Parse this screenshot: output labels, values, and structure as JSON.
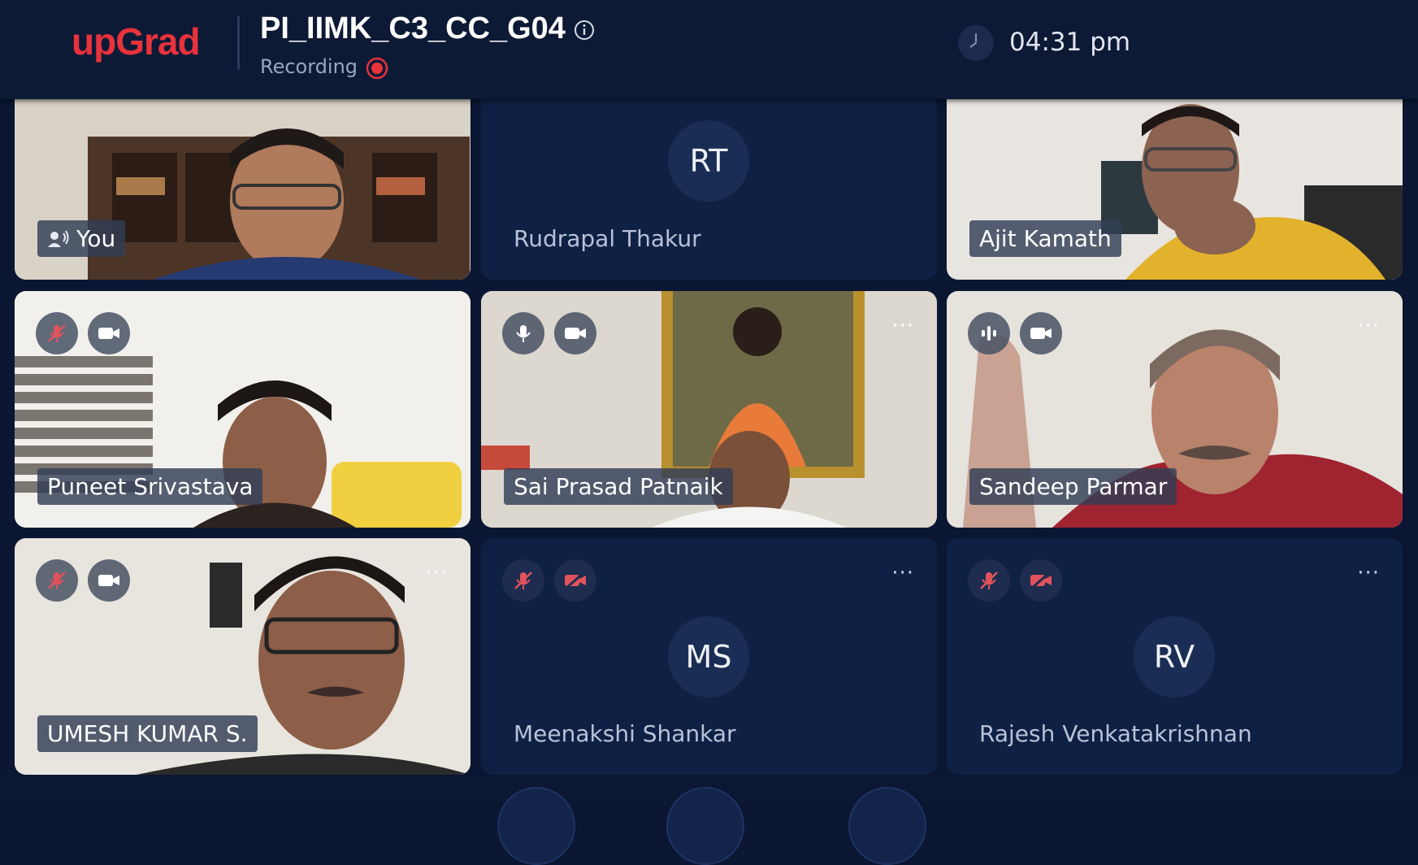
{
  "app": {
    "logo": "upGrad",
    "meeting_title": "PI_IIMK_C3_CC_G04",
    "recording_label": "Recording",
    "clock": "04:31 pm"
  },
  "participants": [
    {
      "name": "You",
      "video": true,
      "colors": [
        "#cfc6b8",
        "#5a3f2e",
        "#2a3a6a"
      ]
    },
    {
      "name": "Rudrapal Thakur",
      "initials": "RT",
      "video": false
    },
    {
      "name": "Ajit Kamath",
      "video": true,
      "colors": [
        "#e9e6e2",
        "#e2b22c",
        "#3b2b26"
      ]
    },
    {
      "name": "Puneet Srivastava",
      "video": true,
      "mic": "muted",
      "colors": [
        "#f1efeb",
        "#f0d040",
        "#2b2320"
      ]
    },
    {
      "name": "Sai Prasad Patnaik",
      "video": true,
      "mic": "on",
      "colors": [
        "#ddd8cf",
        "#e87a3a",
        "#b8902e"
      ]
    },
    {
      "name": "Sandeep Parmar",
      "video": true,
      "mic": "speaking",
      "colors": [
        "#e6e2dc",
        "#a02330",
        "#7c6a60"
      ]
    },
    {
      "name": "UMESH KUMAR S.",
      "video": true,
      "mic": "muted",
      "colors": [
        "#e8e4de",
        "#2a2a2a",
        "#6b5a52"
      ]
    },
    {
      "name": "Meenakshi Shankar",
      "initials": "MS",
      "video": false,
      "mic": "muted",
      "camera": "off"
    },
    {
      "name": "Rajesh Venkatakrishnan",
      "initials": "RV",
      "video": false,
      "mic": "muted",
      "camera": "off"
    }
  ],
  "more_label": "···",
  "colors": {
    "brand": "#e8323c",
    "background": "#0a1632",
    "tile_blank": "#0f2045",
    "muted_red": "#e0535c"
  }
}
